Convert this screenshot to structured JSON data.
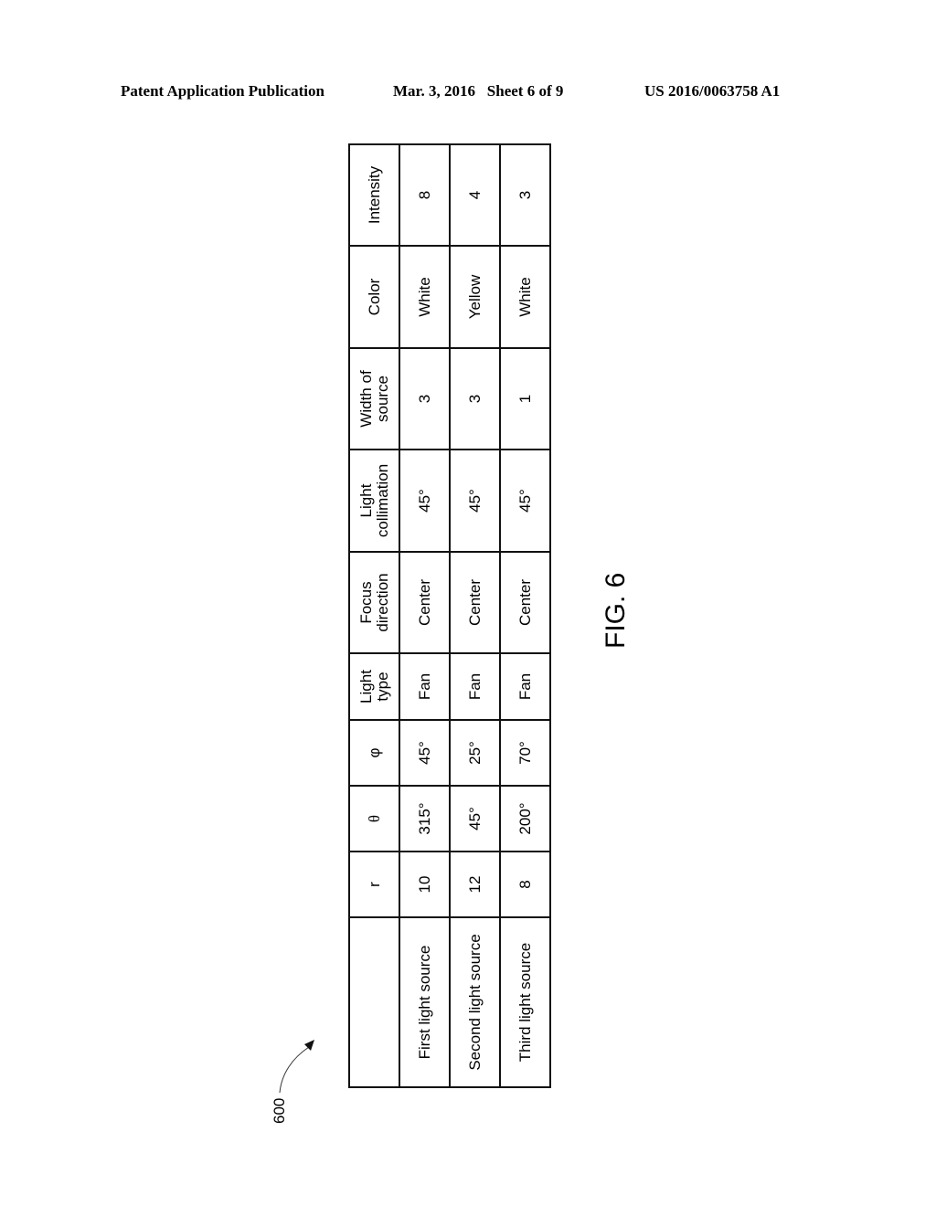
{
  "header": {
    "publication_type": "Patent Application Publication",
    "date_sheet": "Mar. 3, 2016   Sheet 6 of 9",
    "publication_number": "US 2016/0063758 A1"
  },
  "figure": {
    "reference_numeral": "600",
    "caption": "FIG. 6"
  },
  "table": {
    "columns": [
      "",
      "r",
      "θ",
      "φ",
      "Light\ntype",
      "Focus\ndirection",
      "Light\ncollimation",
      "Width of\nsource",
      "Color",
      "Intensity"
    ],
    "rows": [
      [
        "First light source",
        "10",
        "315°",
        "45°",
        "Fan",
        "Center",
        "45°",
        "3",
        "White",
        "8"
      ],
      [
        "Second light source",
        "12",
        "45°",
        "25°",
        "Fan",
        "Center",
        "45°",
        "3",
        "Yellow",
        "4"
      ],
      [
        "Third light source",
        "8",
        "200°",
        "70°",
        "Fan",
        "Center",
        "45°",
        "1",
        "White",
        "3"
      ]
    ]
  }
}
